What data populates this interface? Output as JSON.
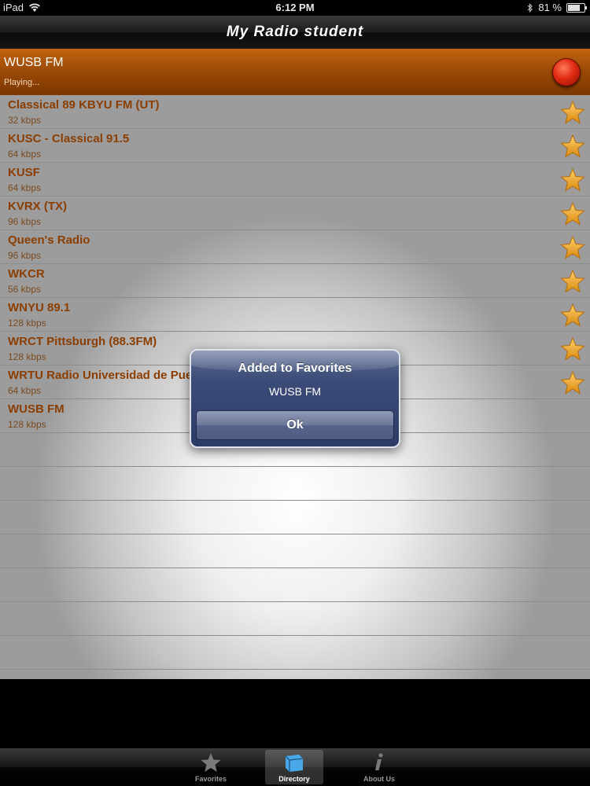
{
  "status_bar": {
    "device": "iPad",
    "time": "6:12 PM",
    "battery": "81 %"
  },
  "nav": {
    "title": "My Radio student"
  },
  "now_playing": {
    "station": "WUSB FM",
    "status": "Playing..."
  },
  "stations": [
    {
      "name": "Classical 89 KBYU FM (UT)",
      "bitrate": "32 kbps",
      "favorite": true
    },
    {
      "name": "KUSC - Classical 91.5",
      "bitrate": "64 kbps",
      "favorite": true
    },
    {
      "name": "KUSF",
      "bitrate": "64 kbps",
      "favorite": true
    },
    {
      "name": "KVRX (TX)",
      "bitrate": "96 kbps",
      "favorite": true
    },
    {
      "name": "Queen's Radio",
      "bitrate": "96 kbps",
      "favorite": true
    },
    {
      "name": "WKCR",
      "bitrate": "56 kbps",
      "favorite": true
    },
    {
      "name": "WNYU 89.1",
      "bitrate": "128 kbps",
      "favorite": true
    },
    {
      "name": "WRCT Pittsburgh (88.3FM)",
      "bitrate": "128 kbps",
      "favorite": true
    },
    {
      "name": "WRTU Radio Universidad de Puerto Rico",
      "bitrate": "64 kbps",
      "favorite": true
    },
    {
      "name": "WUSB FM",
      "bitrate": "128 kbps",
      "favorite": false
    }
  ],
  "alert": {
    "title": "Added to Favorites",
    "message": "WUSB FM",
    "button": "Ok"
  },
  "tabs": [
    {
      "label": "Favorites",
      "icon": "star-icon",
      "active": false
    },
    {
      "label": "Directory",
      "icon": "directory-icon",
      "active": true
    },
    {
      "label": "About Us",
      "icon": "info-icon",
      "active": false
    }
  ],
  "colors": {
    "accent": "#9a4905",
    "station_text": "#8b3e00",
    "alert": "#2c3a66"
  }
}
